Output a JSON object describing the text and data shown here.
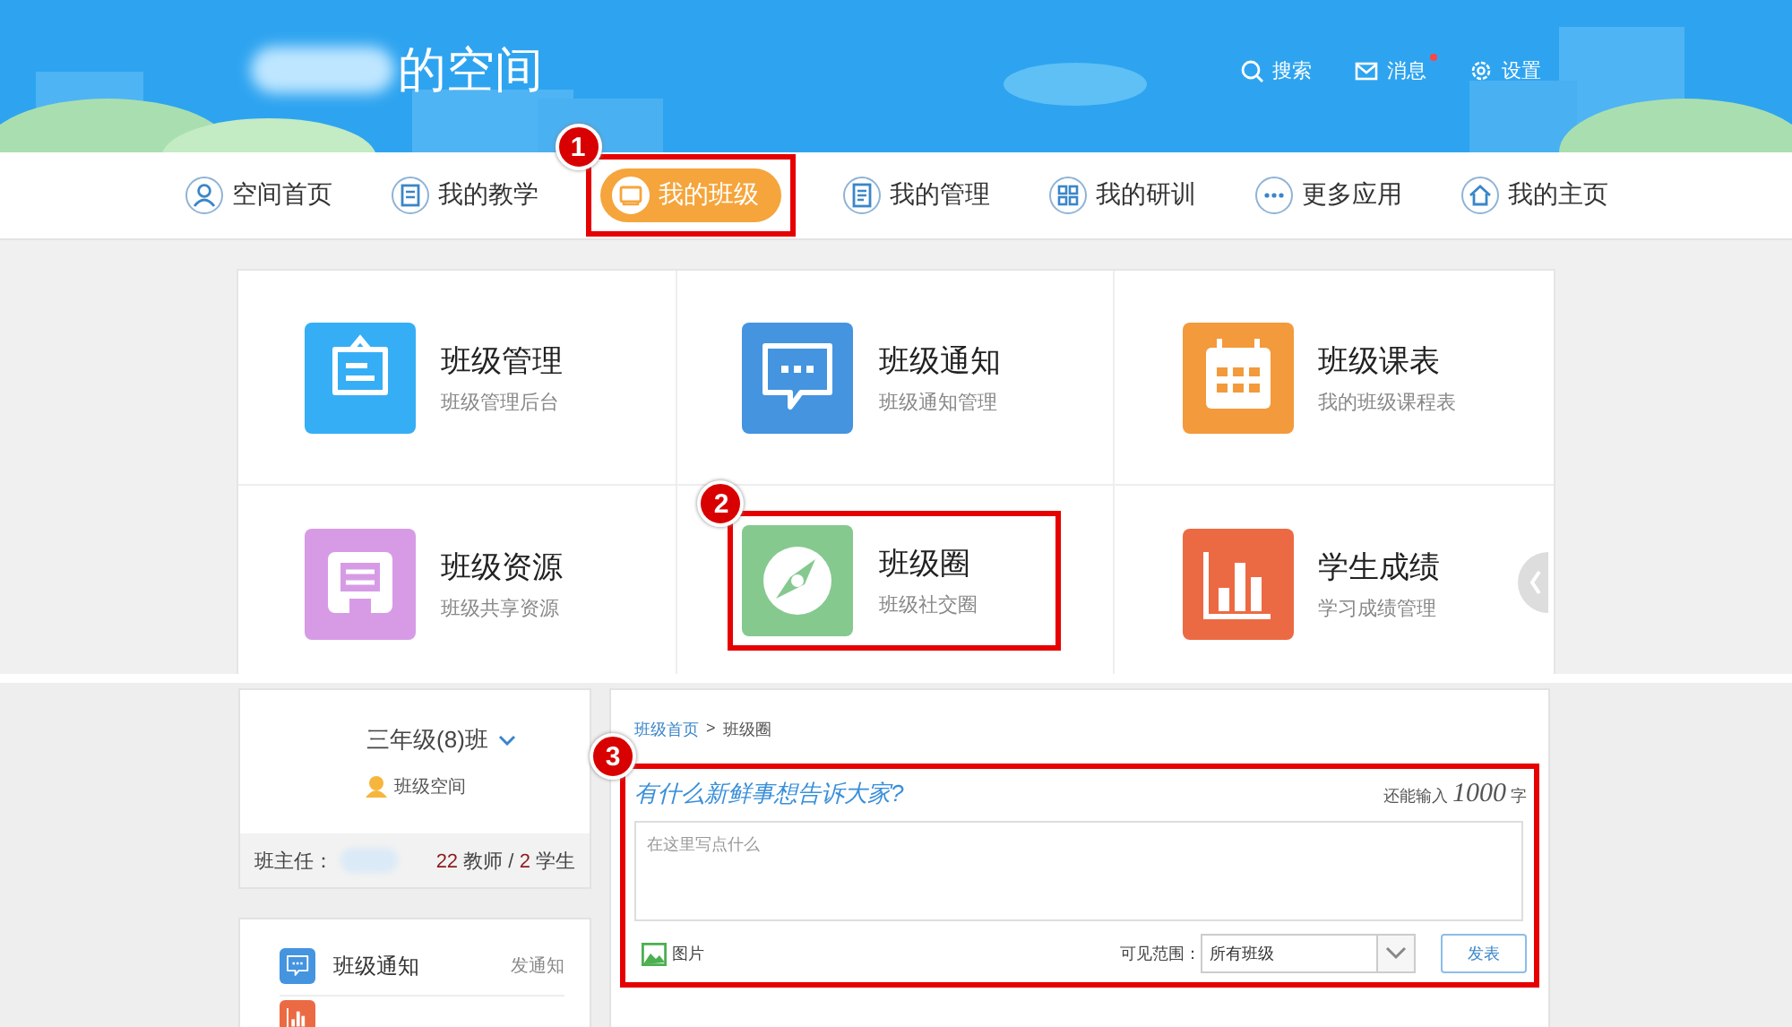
{
  "header": {
    "title": "的空间",
    "actions": [
      {
        "kind": "search",
        "label": "搜索",
        "badge": false
      },
      {
        "kind": "message",
        "label": "消息",
        "badge": true
      },
      {
        "kind": "settings",
        "label": "设置",
        "badge": false
      }
    ]
  },
  "nav": [
    {
      "kind": "user",
      "label": "空间首页",
      "selected": false
    },
    {
      "kind": "book",
      "label": "我的教学",
      "selected": false
    },
    {
      "kind": "class",
      "label": "我的班级",
      "selected": true,
      "annotation": "1"
    },
    {
      "kind": "list",
      "label": "我的管理",
      "selected": false
    },
    {
      "kind": "grid",
      "label": "我的研训",
      "selected": false
    },
    {
      "kind": "more",
      "label": "更多应用",
      "selected": false
    },
    {
      "kind": "home",
      "label": "我的主页",
      "selected": false
    }
  ],
  "apps": [
    {
      "kind": "board",
      "title": "班级管理",
      "subtitle": "班级管理后台",
      "color": "#36aef5"
    },
    {
      "kind": "chat",
      "title": "班级通知",
      "subtitle": "班级通知管理",
      "color": "#4494e0"
    },
    {
      "kind": "calendar",
      "title": "班级课表",
      "subtitle": "我的班级课程表",
      "color": "#f39a3c"
    },
    {
      "kind": "doc",
      "title": "班级资源",
      "subtitle": "班级共享资源",
      "color": "#d79be6"
    },
    {
      "kind": "compass",
      "title": "班级圈",
      "subtitle": "班级社交圈",
      "color": "#85c98f",
      "annotation": "2"
    },
    {
      "kind": "bars",
      "title": "学生成绩",
      "subtitle": "学习成绩管理",
      "color": "#ec6a43"
    }
  ],
  "class_card": {
    "class_name": "三年级(8)班",
    "space_link": "班级空间",
    "head_teacher_label": "班主任：",
    "teacher_count": "22",
    "teacher_label": "教师 /",
    "student_count": "2",
    "student_label": "学生"
  },
  "side_list": [
    {
      "kind": "chat",
      "label": "班级通知",
      "action": "发通知",
      "color": "#4494e0"
    },
    {
      "kind": "bars",
      "color": "#ec6a43"
    }
  ],
  "post": {
    "breadcrumb": [
      {
        "label": "班级首页",
        "link": true
      },
      {
        "label": ">",
        "link": false
      },
      {
        "label": "班级圈",
        "link": false
      }
    ],
    "annotation": "3",
    "prompt": "有什么新鲜事想告诉大家?",
    "remaining_label": "还能输入",
    "remaining_count": "1000",
    "remaining_unit": "字",
    "placeholder": "在这里写点什么",
    "image_button": "图片",
    "visibility_label": "可见范围：",
    "visibility_value": "所有班级",
    "submit": "发表"
  }
}
